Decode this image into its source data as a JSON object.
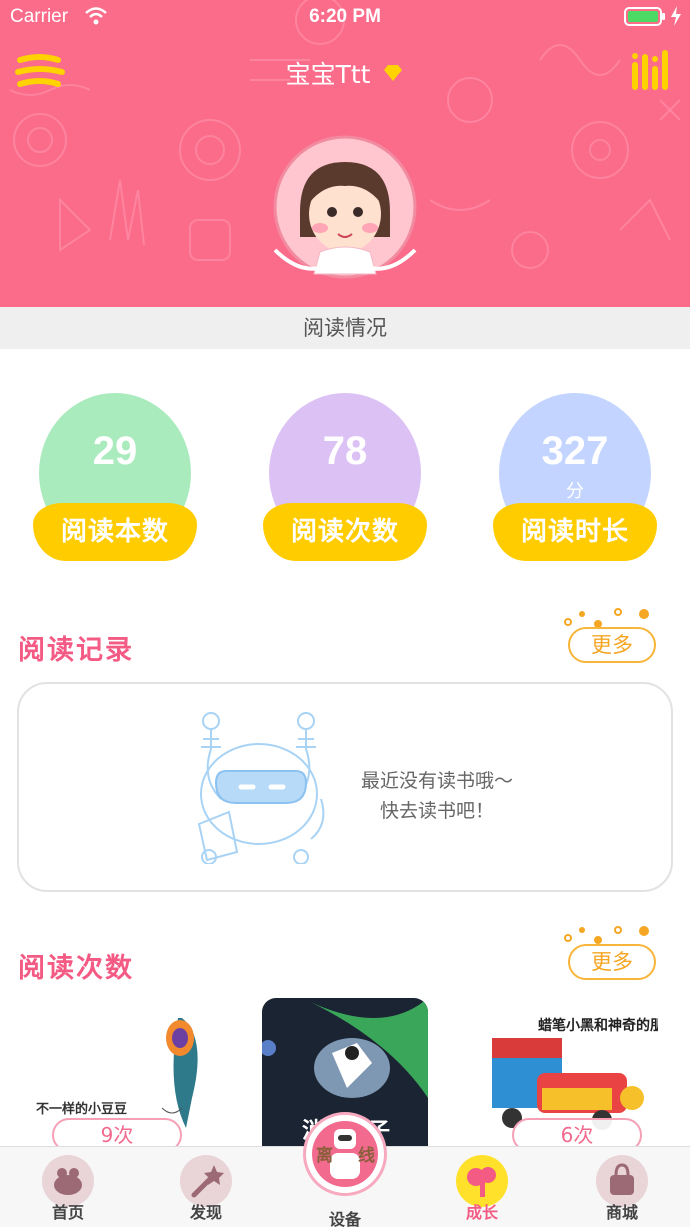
{
  "status_bar": {
    "carrier": "Carrier",
    "time": "6:20 PM"
  },
  "header": {
    "username": "宝宝Ttt"
  },
  "section_label": "阅读情况",
  "stats": [
    {
      "value": "29",
      "unit": "",
      "label": "阅读本数",
      "color": "#a9ebbd"
    },
    {
      "value": "78",
      "unit": "",
      "label": "阅读次数",
      "color": "#dcc1f5"
    },
    {
      "value": "327",
      "unit": "分",
      "label": "阅读时长",
      "color": "#c2d4ff"
    }
  ],
  "reading_record": {
    "title": "阅读记录",
    "more_label": "更多",
    "empty_line1": "最近没有读书哦～",
    "empty_line2": "快去读书吧！"
  },
  "reading_count": {
    "title": "阅读次数",
    "more_label": "更多",
    "books": [
      {
        "count": "9次",
        "cover_title": "不一样的小豆豆"
      },
      {
        "count": "",
        "cover_title": "消闪亦子"
      },
      {
        "count": "6次",
        "cover_title": "蜡笔小黑和神奇的朋"
      }
    ]
  },
  "tabbar": {
    "items": [
      {
        "label": "首页"
      },
      {
        "label": "发现"
      },
      {
        "label": "设备",
        "badge_left": "离",
        "badge_right": "线"
      },
      {
        "label": "成长"
      },
      {
        "label": "商城"
      }
    ]
  },
  "colors": {
    "header": "#fb6b8a",
    "accent_pink": "#f45b84",
    "accent_yellow": "#ffcc00",
    "more_border": "#f7b53a"
  }
}
